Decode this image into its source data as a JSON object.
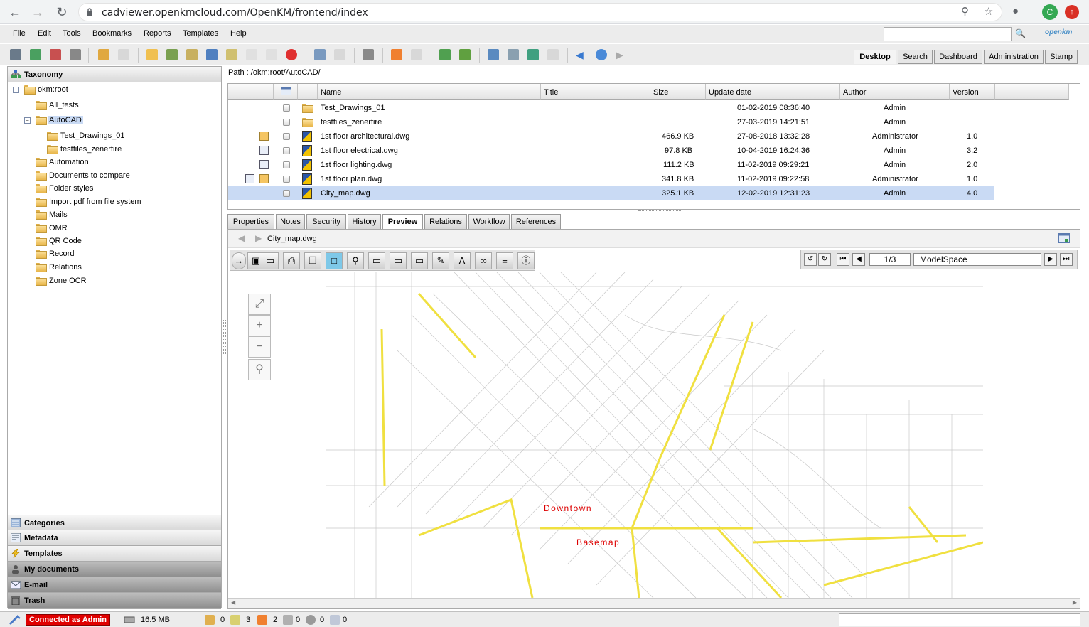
{
  "browser": {
    "url": "cadviewer.openkmcloud.com/OpenKM/frontend/index",
    "avatar_letter": "C"
  },
  "menu": [
    "File",
    "Edit",
    "Tools",
    "Bookmarks",
    "Reports",
    "Templates",
    "Help"
  ],
  "logo": "openkm",
  "workspace_tabs": [
    "Desktop",
    "Search",
    "Dashboard",
    "Administration",
    "Stamp"
  ],
  "left_panel": {
    "title": "Taxonomy",
    "root": "okm:root",
    "tree": [
      {
        "label": "All_tests"
      },
      {
        "label": "AutoCAD",
        "children": [
          "Test_Drawings_01",
          "testfiles_zenerfire"
        ]
      },
      {
        "label": "Automation"
      },
      {
        "label": "Documents to compare"
      },
      {
        "label": "Folder styles"
      },
      {
        "label": "Import pdf from file system"
      },
      {
        "label": "Mails"
      },
      {
        "label": "OMR"
      },
      {
        "label": "QR Code"
      },
      {
        "label": "Record"
      },
      {
        "label": "Relations"
      },
      {
        "label": "Zone OCR"
      }
    ],
    "stacks": [
      "Categories",
      "Metadata",
      "Templates",
      "My documents",
      "E-mail",
      "Trash"
    ]
  },
  "path": "Path : /okm:root/AutoCAD/",
  "columns": [
    "Name",
    "Title",
    "Size",
    "Update date",
    "Author",
    "Version"
  ],
  "files": [
    {
      "name": "Test_Drawings_01",
      "size": "",
      "date": "01-02-2019 08:36:40",
      "author": "Admin",
      "version": "",
      "type": "folder"
    },
    {
      "name": "testfiles_zenerfire",
      "size": "",
      "date": "27-03-2019 14:21:51",
      "author": "Admin",
      "version": "",
      "type": "folder"
    },
    {
      "name": "1st floor architectural.dwg",
      "size": "466.9 KB",
      "date": "27-08-2018 13:32:28",
      "author": "Administrator",
      "version": "1.0",
      "type": "dwg"
    },
    {
      "name": "1st floor electrical.dwg",
      "size": "97.8 KB",
      "date": "10-04-2019 16:24:36",
      "author": "Admin",
      "version": "3.2",
      "type": "dwg"
    },
    {
      "name": "1st floor lighting.dwg",
      "size": "111.2 KB",
      "date": "11-02-2019 09:29:21",
      "author": "Admin",
      "version": "2.0",
      "type": "dwg"
    },
    {
      "name": "1st floor plan.dwg",
      "size": "341.8 KB",
      "date": "11-02-2019 09:22:58",
      "author": "Administrator",
      "version": "1.0",
      "type": "dwg"
    },
    {
      "name": "City_map.dwg",
      "size": "325.1 KB",
      "date": "12-02-2019 12:31:23",
      "author": "Admin",
      "version": "4.0",
      "type": "dwg"
    }
  ],
  "detail_tabs": [
    "Properties",
    "Notes",
    "Security",
    "History",
    "Preview",
    "Relations",
    "Workflow",
    "References"
  ],
  "preview": {
    "filename": "City_map.dwg",
    "page": "1/3",
    "layout": "ModelSpace",
    "map_labels": [
      "Downtown",
      "Basemap"
    ]
  },
  "status": {
    "connected": "Connected as Admin",
    "memory": "16.5 MB",
    "counts": [
      "0",
      "3",
      "2",
      "0",
      "0",
      "0"
    ]
  }
}
